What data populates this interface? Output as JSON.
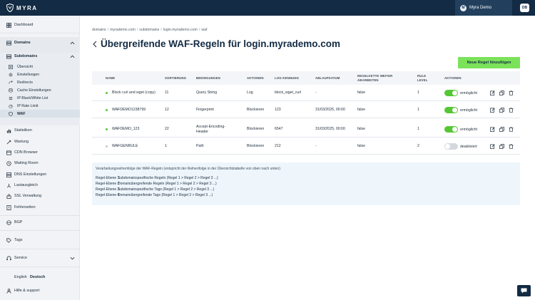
{
  "brand": {
    "name": "MYRA"
  },
  "account": {
    "initials": "M",
    "name": "Myra Demo",
    "user_initials": "DB"
  },
  "colors": {
    "topbar": "#132b44",
    "accent_green": "#7be25a",
    "toggle_on": "#55c734",
    "toggle_off": "#d4d9df",
    "dot_active": "#55c734",
    "dot_inactive": "#c3c9d0",
    "info_bg": "#eef6fc"
  },
  "sidebar": {
    "dashboard": {
      "label": "Dashboard",
      "icon": "dashboard-icon"
    },
    "domains": {
      "label": "Domains",
      "icon": "domains-icon"
    },
    "subdomains": {
      "label": "Subdomains",
      "icon": "subdomains-icon"
    },
    "sub_items": [
      {
        "label": "Übersicht",
        "icon": "overview-icon"
      },
      {
        "label": "Einstellungen",
        "icon": "settings-icon"
      },
      {
        "label": "Redirects",
        "icon": "redirect-icon"
      },
      {
        "label": "Cache Einstellungen",
        "icon": "cache-icon"
      },
      {
        "label": "IP Black/White List",
        "icon": "list-icon"
      },
      {
        "label": "IP Rate Limit",
        "icon": "rate-limit-icon"
      },
      {
        "label": "WAF",
        "icon": "waf-icon",
        "active": true
      }
    ],
    "items": [
      {
        "label": "Statistiken",
        "icon": "statistics-icon"
      },
      {
        "label": "Wartung",
        "icon": "maintenance-icon"
      },
      {
        "label": "CDN Browser",
        "icon": "cdn-icon"
      },
      {
        "label": "Waiting Room",
        "icon": "waiting-room-icon"
      },
      {
        "label": "DNS Einstellungen",
        "icon": "dns-icon"
      },
      {
        "label": "Lastausgleich",
        "icon": "load-balancer-icon"
      },
      {
        "label": "SSL Verwaltung",
        "icon": "ssl-icon"
      },
      {
        "label": "Fehlerseiten",
        "icon": "error-pages-icon"
      }
    ],
    "bgp": {
      "label": "BGP",
      "icon": "bgp-icon"
    },
    "tags": {
      "label": "Tags",
      "icon": "tag-icon"
    },
    "service": {
      "label": "Service",
      "icon": "service-icon"
    },
    "language": {
      "en": "English",
      "de": "Deutsch"
    },
    "help": {
      "label": "Hilfe & support",
      "icon": "help-icon"
    }
  },
  "breadcrumb": [
    "domains",
    "myrademo.com",
    "subdomains",
    "login.myrademo.com",
    "waf"
  ],
  "page": {
    "title": "Übergreifende WAF-Regeln für login.myrademo.com",
    "add_button": "Neue Regel hinzufügen"
  },
  "table": {
    "headers": {
      "name": "NAME",
      "sort": "SORTIERUNG",
      "conditions": "BEDINGUNGEN",
      "actions": "AKTIONEN",
      "log": "LOG-KENNUNG",
      "expiry": "ABLAUFDATUM",
      "continue": "REGELKETTE WEITER ABARBEITEN",
      "level": "RULE LEVEL",
      "row_actions": "AKTIONEN"
    },
    "rows": [
      {
        "name": "Block curl and wget (copy)",
        "sort": "11",
        "condition": "Query String",
        "action": "Log",
        "log": "block_wget_curl",
        "expiry": "-",
        "continue": "false",
        "level": "1",
        "enabled": true,
        "toggle_label": "ermöglicht"
      },
      {
        "name": "WAFDEMO1238799",
        "sort": "12",
        "condition": "Fingerprint",
        "action": "Blockieren",
        "log": "123",
        "expiry": "31/03/2025, 00:00",
        "continue": "false",
        "level": "1",
        "enabled": true,
        "toggle_label": "ermöglicht"
      },
      {
        "name": "WAFDEMO_123",
        "sort": "22",
        "condition": "Accept-Encoding-Header",
        "action": "Blockieren",
        "log": "6547",
        "expiry": "31/03/2025, 00:00",
        "continue": "false",
        "level": "1",
        "enabled": true,
        "toggle_label": "ermöglicht"
      },
      {
        "name": "WAFGENRULE",
        "sort": "1",
        "condition": "Path",
        "action": "Blockieren",
        "log": "212",
        "expiry": "-",
        "continue": "false",
        "level": "2",
        "enabled": false,
        "toggle_label": "deaktiviert"
      }
    ]
  },
  "info": {
    "title": "Verarbeitungsreihenfolge der WAF-Regeln (entspricht der Reihenfolge in der Übersichtstabelle von oben nach unten)",
    "levels": [
      {
        "level": "Regel-Ebene 1",
        "text": "Subdomainspezifische Regeln (Regel 1 > Regel 2 > Regel 3 ...)"
      },
      {
        "level": "Regel-Ebene 2",
        "text": "Domainübergreifende Regeln (Regel 1 > Regel 2 > Regel 3 ...)"
      },
      {
        "level": "Regel-Ebene 3",
        "text": "Subdomainspezifische Tags (Regel 1 > Regel 2 > Regel 3 ...)"
      },
      {
        "level": "Regel-Ebene 4",
        "text": "Domainübergreifende Tags (Regel 1 > Regel 2 > Regel 3 ...)"
      }
    ]
  },
  "chat": {
    "icon": "chat-icon"
  }
}
